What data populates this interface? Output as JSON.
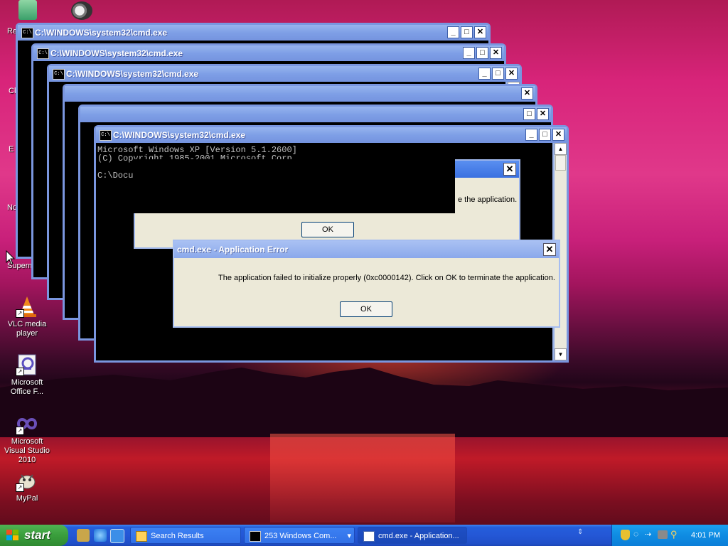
{
  "desktop": {
    "icons": [
      {
        "label": "VLC media player"
      },
      {
        "label": "Microsoft Office F..."
      },
      {
        "label": "Microsoft Visual Studio 2010"
      },
      {
        "label": "MyPal"
      }
    ],
    "peeking": [
      "Re",
      "Cl",
      "E",
      "No",
      "Superm"
    ]
  },
  "windows": {
    "cmd_title": "C:\\WINDOWS\\system32\\cmd.exe",
    "icon_text": "C:\\",
    "front_console": "Microsoft Windows XP [Version 5.1.2600]\n(C) Copyright 1985-2001 Microsoft Corp.\n\nC:\\Docu",
    "minimize": "_",
    "maximize": "□",
    "close": "✕"
  },
  "back_dialog": {
    "message_tail": "e the application.",
    "ok": "OK",
    "close": "✕"
  },
  "error_dialog": {
    "title": "cmd.exe - Application Error",
    "message": "The application failed to initialize properly (0xc0000142). Click on OK to terminate the application.",
    "ok": "OK",
    "close": "✕"
  },
  "taskbar": {
    "start": "start",
    "tasks": [
      {
        "label": "Search Results"
      },
      {
        "label": "253 Windows Com..."
      },
      {
        "label": "cmd.exe - Application..."
      }
    ],
    "clock": "4:01 PM"
  },
  "colors": {
    "xp_blue": "#245edb",
    "start_green": "#3a9e3c",
    "console_bg": "#000000"
  }
}
